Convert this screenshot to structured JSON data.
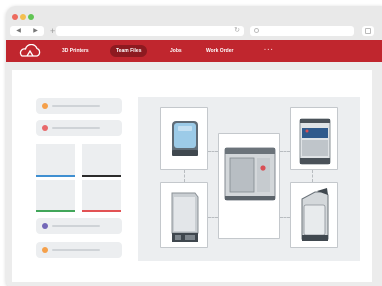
{
  "browser": {
    "back_icon": "◀",
    "forward_icon": "▶",
    "newtab_icon": "+",
    "reload_icon": "↻"
  },
  "app": {
    "brand_color": "#c0262e",
    "nav": [
      {
        "label": "3D Printers"
      },
      {
        "label": "Team Files",
        "active": true
      },
      {
        "label": "Jobs"
      },
      {
        "label": "Work Order"
      }
    ],
    "more_label": "···"
  },
  "sidebar": {
    "items_top": [
      {
        "bullet_color": "#f5a04a"
      },
      {
        "bullet_color": "#e8696b"
      }
    ],
    "items_bottom": [
      {
        "bullet_color": "#7468b8"
      },
      {
        "bullet_color": "#f5a04a"
      }
    ],
    "tiles": [
      {
        "stripe_color": "#3f8fd1"
      },
      {
        "stripe_color": "#2b2b2b"
      },
      {
        "stripe_color": "#42a65a"
      },
      {
        "stripe_color": "#e25254"
      }
    ]
  },
  "diagram": {
    "center_device": "printer-cabinet",
    "connected_devices": [
      "resin-printer",
      "filament-box",
      "wash-station",
      "post-processor"
    ]
  }
}
